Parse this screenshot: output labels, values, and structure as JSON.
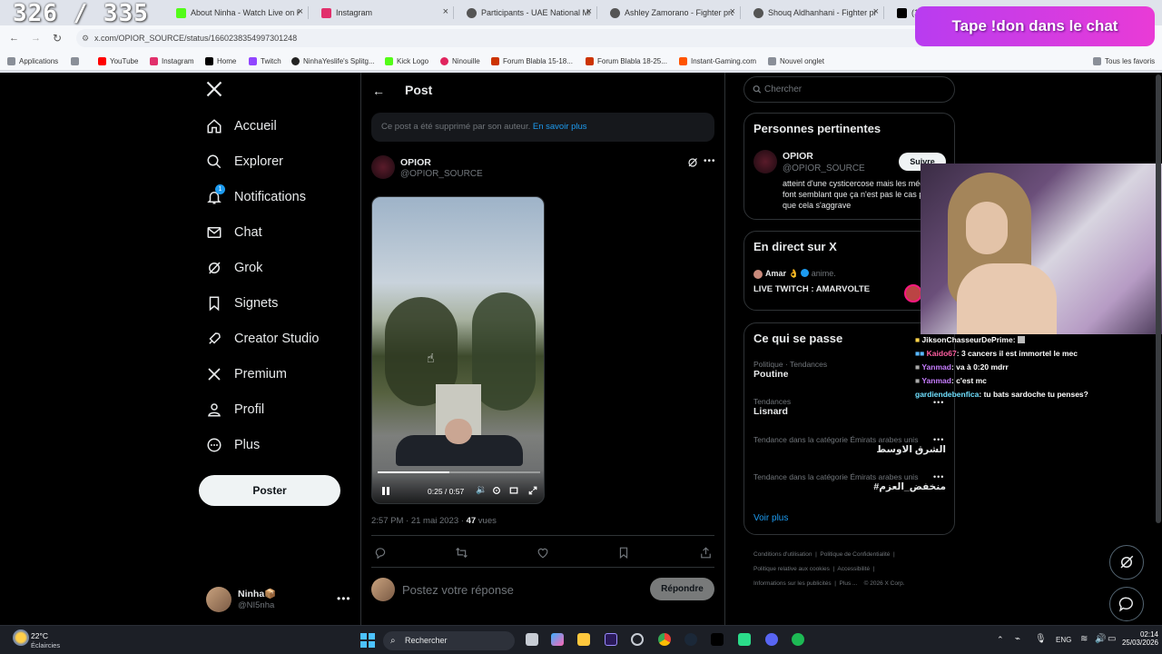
{
  "counter": "326 / 335",
  "tabs": [
    {
      "title": "About Ninha - Watch Live on K",
      "color": "#53fc18"
    },
    {
      "title": "Instagram",
      "color": "#e1306c"
    },
    {
      "title": "Participants - UAE National Mi",
      "color": "#555555"
    },
    {
      "title": "Ashley Zamorano - Fighter pro",
      "color": "#555555"
    },
    {
      "title": "Shouq Aldhanhani - Fighter pr",
      "color": "#555555"
    },
    {
      "title": "(1",
      "color": "#000000"
    }
  ],
  "url": "x.com/OPIOR_SOURCE/status/1660238354997301248",
  "bookmarks": [
    {
      "label": "Applications",
      "color": "#777777"
    },
    {
      "label": "",
      "color": "#777777"
    },
    {
      "label": "YouTube",
      "color": "#ff0000"
    },
    {
      "label": "Instagram",
      "color": "#e1306c"
    },
    {
      "label": "Home",
      "color": "#000000"
    },
    {
      "label": "Twitch",
      "color": "#9146ff"
    },
    {
      "label": "NinhaYeslife's Splitg...",
      "color": "#222222"
    },
    {
      "label": "Kick Logo",
      "color": "#53fc18"
    },
    {
      "label": "Ninouille",
      "color": "#e0245e"
    },
    {
      "label": "Forum Blabla 15-18...",
      "color": "#cc3300"
    },
    {
      "label": "Forum Blabla 18-25...",
      "color": "#cc3300"
    },
    {
      "label": "Instant-Gaming.com",
      "color": "#ff5400"
    },
    {
      "label": "Nouvel onglet",
      "color": "#777777"
    }
  ],
  "all_bookmarks": "Tous les favoris",
  "overlay_banner": "Tape !don dans le chat",
  "nav": {
    "items": [
      {
        "label": "Accueil",
        "icon": "home-icon"
      },
      {
        "label": "Explorer",
        "icon": "search-icon"
      },
      {
        "label": "Notifications",
        "icon": "bell-icon",
        "badge": "1"
      },
      {
        "label": "Chat",
        "icon": "mail-icon"
      },
      {
        "label": "Grok",
        "icon": "grok-icon"
      },
      {
        "label": "Signets",
        "icon": "bookmark-icon"
      },
      {
        "label": "Creator Studio",
        "icon": "rocket-icon"
      },
      {
        "label": "Premium",
        "icon": "x-logo-icon"
      },
      {
        "label": "Profil",
        "icon": "person-icon"
      },
      {
        "label": "Plus",
        "icon": "more-circle-icon"
      }
    ],
    "post_button": "Poster",
    "account": {
      "name": "Ninha📦",
      "handle": "@NI5nha"
    }
  },
  "main": {
    "header_title": "Post",
    "deleted_notice": "Ce post a été supprimé par son auteur.",
    "deleted_link": "En savoir plus",
    "author_name": "OPIOR",
    "author_handle": "@OPIOR_SOURCE",
    "video": {
      "time": "0:25 / 0:57",
      "progress": 0.44
    },
    "timestamp": "2:57 PM · 21 mai 2023 · ",
    "views_count": "47",
    "views_label": " vues",
    "reply_placeholder": "Postez votre réponse",
    "reply_button": "Répondre"
  },
  "right": {
    "search_placeholder": "Chercher",
    "relevant": {
      "title": "Personnes pertinentes",
      "name": "OPIOR",
      "handle": "@OPIOR_SOURCE",
      "follow": "Suivre",
      "bio": "atteint d'une cysticercose mais les médecins font semblant que ça n'est pas le cas pour que cela s'aggrave"
    },
    "live": {
      "title": "En direct sur X",
      "host": "Amar 👌",
      "host_suffix": "anime.",
      "stream_title": "LIVE TWITCH : AMARVOLTE"
    },
    "trends": {
      "title": "Ce qui se passe",
      "items": [
        {
          "category": "Politique · Tendances",
          "name": "Poutine"
        },
        {
          "category": "Tendances",
          "name": "Lisnard"
        },
        {
          "category": "Tendance dans la catégorie Émirats arabes unis",
          "name": "الشرق الاوسط"
        },
        {
          "category": "Tendance dans la catégorie Émirats arabes unis",
          "name": "#منخفض_العزم"
        }
      ],
      "show_more": "Voir plus"
    },
    "footer": [
      "Conditions d'utilisation",
      "Politique de Confidentialité",
      "Politique relative aux cookies",
      "Accessibilité",
      "Informations sur les publicités",
      "Plus ...",
      "© 2026 X Corp."
    ]
  },
  "chat": [
    {
      "user": "JiksonChasseurDePrime",
      "user_color": "#ffffff",
      "message": ""
    },
    {
      "user": "Kaido67",
      "user_color": "#ff5fa2",
      "message": "3 cancers il est immortel le mec"
    },
    {
      "user": "Yanmad",
      "user_color": "#c77dff",
      "message": "va à 0:20 mdrr"
    },
    {
      "user": "Yanmad",
      "user_color": "#c77dff",
      "message": "c'est mc"
    },
    {
      "user": "gardiendebenfica",
      "user_color": "#6fe0ff",
      "message": "tu bats sardoche tu penses?"
    }
  ],
  "taskbar": {
    "weather_temp": "22°C",
    "weather_desc": "Éclaircies",
    "search": "Rechercher",
    "lang": "ENG",
    "time": "02:14",
    "date": "25/03/2026"
  }
}
